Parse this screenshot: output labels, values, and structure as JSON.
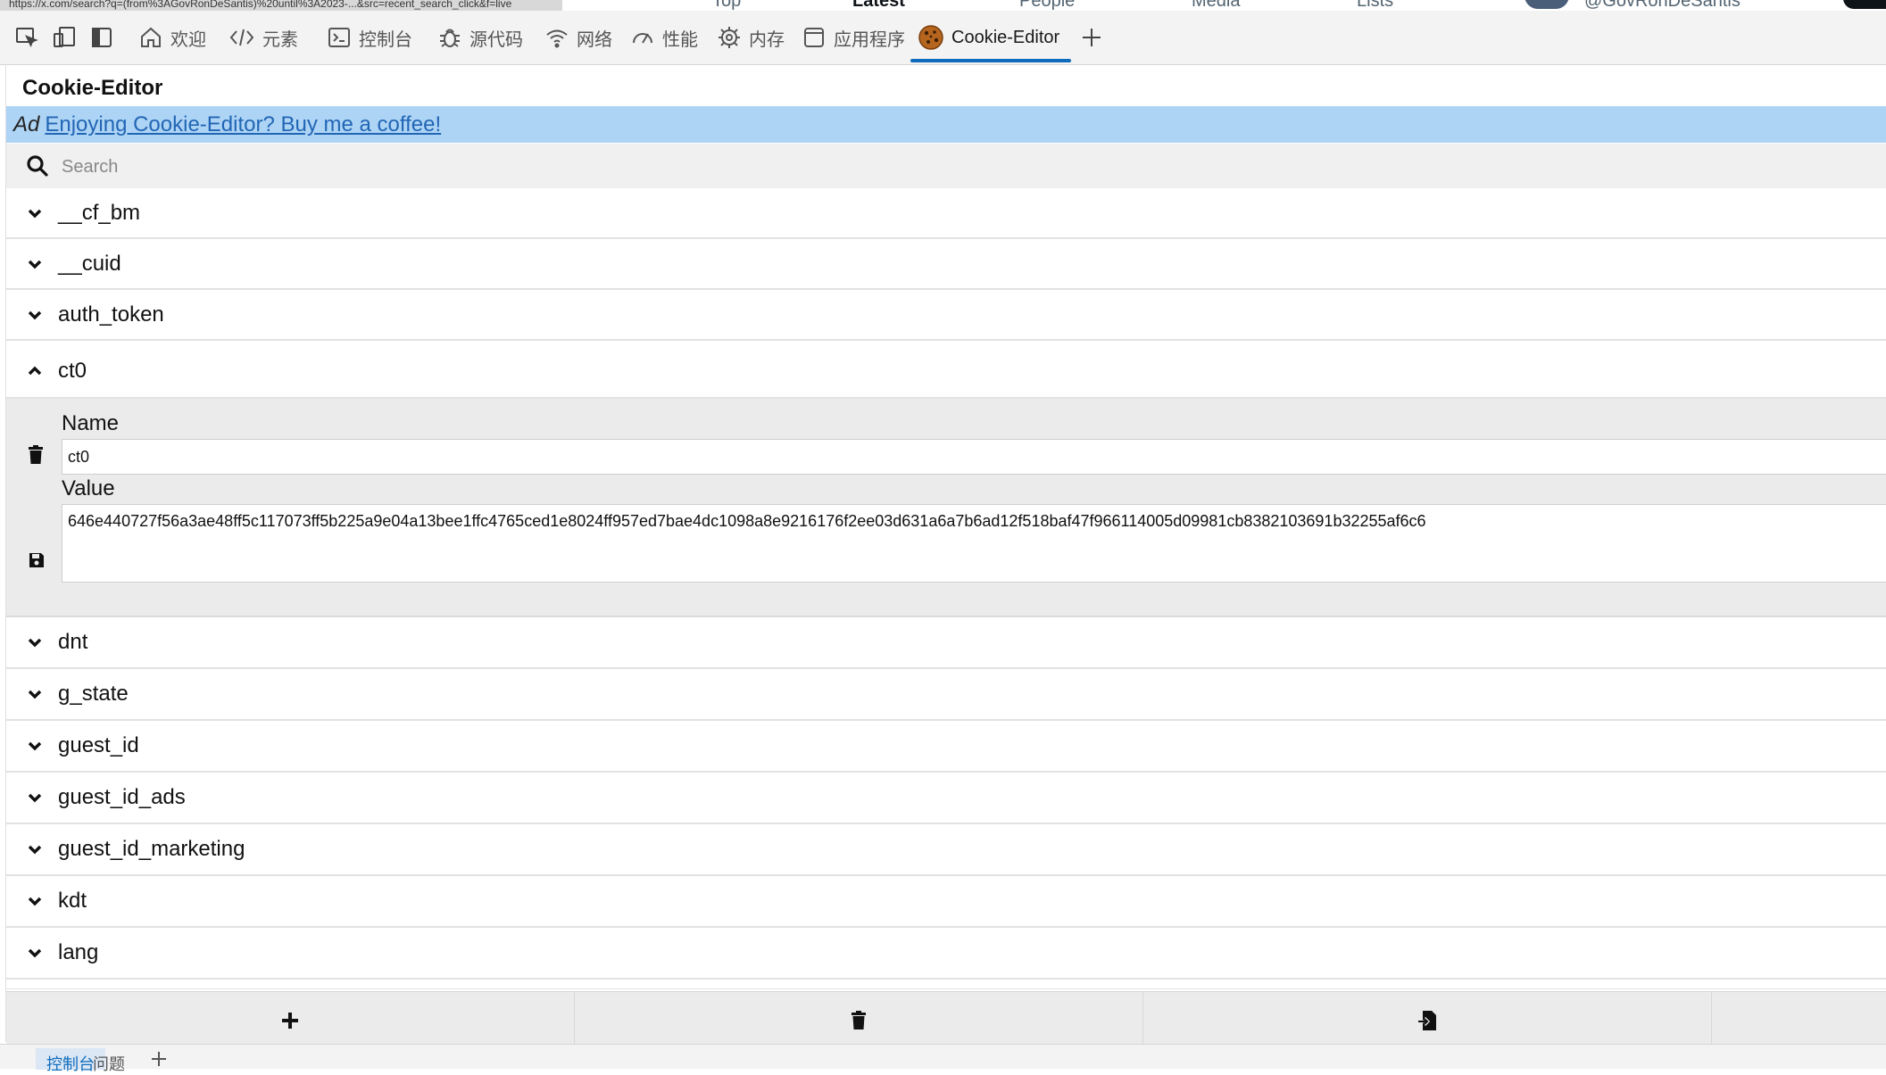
{
  "browser": {
    "url_text": "https://x.com/search?q=(from%3AGovRonDeSantis)%20until%3A2023-...&src=recent_search_click&f=live",
    "page_tabs": [
      "Top",
      "Latest",
      "People",
      "Media",
      "Lists"
    ],
    "account_handle": "@GovRonDeSantis"
  },
  "devtools": {
    "tabs": [
      {
        "label": "欢迎",
        "icon": "home-icon"
      },
      {
        "label": "元素",
        "icon": "code-icon"
      },
      {
        "label": "控制台",
        "icon": "console-icon"
      },
      {
        "label": "源代码",
        "icon": "bug-icon"
      },
      {
        "label": "网络",
        "icon": "wifi-icon"
      },
      {
        "label": "性能",
        "icon": "gauge-icon"
      },
      {
        "label": "内存",
        "icon": "chip-icon"
      },
      {
        "label": "应用程序",
        "icon": "window-icon"
      },
      {
        "label": "Cookie-Editor",
        "icon": "cookie-icon",
        "active": true
      }
    ],
    "accent_color": "#0f6cbd"
  },
  "extension": {
    "title": "Cookie-Editor",
    "ad": {
      "tag": "Ad",
      "link_text": "Enjoying Cookie-Editor? Buy me a coffee!"
    },
    "search": {
      "placeholder": "Search",
      "value": ""
    },
    "cookies": [
      {
        "name": "__cf_bm",
        "expanded": false
      },
      {
        "name": "__cuid",
        "expanded": false
      },
      {
        "name": "auth_token",
        "expanded": false
      },
      {
        "name": "ct0",
        "expanded": true
      },
      {
        "name": "dnt",
        "expanded": false
      },
      {
        "name": "g_state",
        "expanded": false
      },
      {
        "name": "guest_id",
        "expanded": false
      },
      {
        "name": "guest_id_ads",
        "expanded": false
      },
      {
        "name": "guest_id_marketing",
        "expanded": false
      },
      {
        "name": "kdt",
        "expanded": false
      },
      {
        "name": "lang",
        "expanded": false
      }
    ],
    "detail": {
      "name_label": "Name",
      "name_value": "ct0",
      "value_label": "Value",
      "value_value": "646e440727f56a3ae48ff5c117073ff5b225a9e04a13bee1ffc4765ced1e8024ff957ed7bae4dc1098a8e9216176f2ee03d631a6a7b6ad12f518baf47f966114005d09981cb8382103691b32255af6c6"
    },
    "ad_bar_color": "#aed4f5",
    "link_color": "#2166b5"
  },
  "drawer": {
    "tabs": [
      {
        "label": "控制台",
        "active": true
      },
      {
        "label": "问题",
        "active": false
      }
    ]
  }
}
